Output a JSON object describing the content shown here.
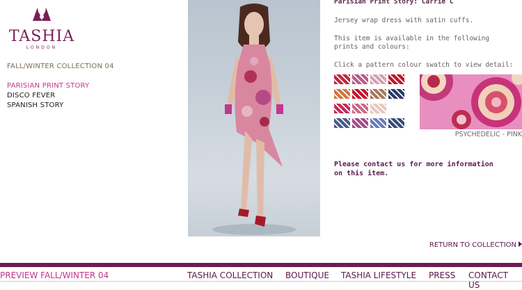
{
  "brand": {
    "name": "TASHIA",
    "subtitle": "LONDON",
    "color": "#7a1f57"
  },
  "sidebar": {
    "collection_title": "FALL/WINTER COLLECTION 04",
    "items": [
      {
        "label": "PARISIAN PRINT STORY",
        "active": true
      },
      {
        "label": "DISCO FEVER"
      },
      {
        "label": "SPANISH STORY"
      }
    ]
  },
  "product": {
    "story_title": "Parisian Print Story: Carrie C",
    "description": "Jersey wrap dress with satin cuffs.",
    "availability": "This item is available in the following prints and colours:",
    "instruction": "Click a pattern colour swatch to view detail:",
    "selected_swatch_label": "PSYCHEDELIC - PINK",
    "contact_text": "Please contact us for more information on this item."
  },
  "swatches": {
    "colors": [
      [
        "#c0263b",
        "#b85a8a",
        "#d4a0b4",
        "#b81a2e"
      ],
      [
        "#d2763a",
        "#c8102e",
        "#a8785a",
        "#2a3a6a"
      ],
      [
        "#c52a5a",
        "#c86a8a",
        "#e7c8c0"
      ],
      [
        "#4a5a8a",
        "#a44a8a",
        "#6a7aba",
        "#3a4a7a"
      ]
    ]
  },
  "return_link": "RETURN TO COLLECTION",
  "footer": {
    "preview_link": "PREVIEW FALL/WINTER 04",
    "nav": [
      "TASHIA COLLECTION",
      "BOUTIQUE",
      "TASHIA LIFESTYLE",
      "PRESS",
      "CONTACT US"
    ],
    "bar_color": "#6e1d54"
  },
  "colors": {
    "accent_pink": "#c2368f",
    "dark_plum": "#5a1a4e"
  }
}
